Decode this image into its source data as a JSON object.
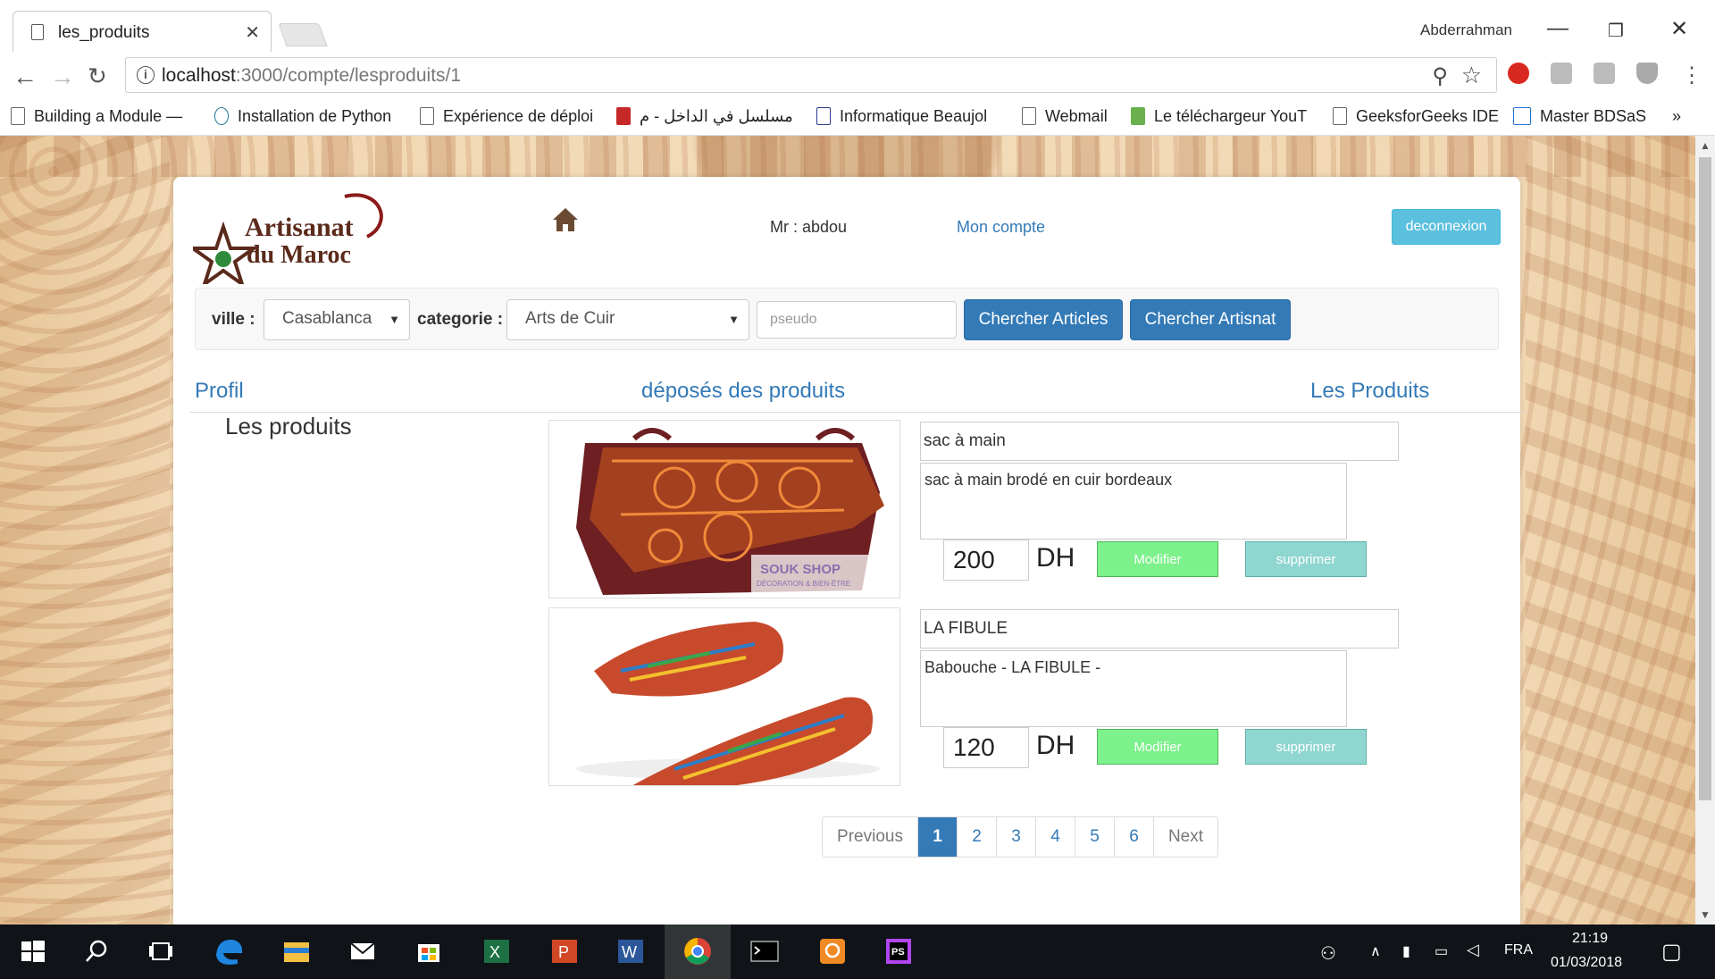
{
  "browser": {
    "tab_title": "les_produits",
    "user": "Abderrahman",
    "url_host": "localhost",
    "url_rest": ":3000/compte/lesproduits/1",
    "bookmarks": [
      "Building a Module —",
      "Installation de Python",
      "Expérience de déploi",
      "مسلسل في الداخل - م",
      "Informatique Beaujol",
      "Webmail",
      "Le téléchargeur YouT",
      "GeeksforGeeks IDE",
      "Master BDSaS"
    ],
    "more": "»"
  },
  "header": {
    "logo_line1": "Artisanat",
    "logo_line2": "du Maroc",
    "greeting": "Mr : abdou",
    "account_link": "Mon compte",
    "logout": "deconnexion"
  },
  "search": {
    "ville_label": "ville :",
    "ville_value": "Casablanca",
    "categorie_label": "categorie :",
    "categorie_value": "Arts de Cuir",
    "pseudo_placeholder": "pseudo",
    "btn_articles": "Chercher Articles",
    "btn_artisanat": "Chercher Artisnat"
  },
  "nav": {
    "profil": "Profil",
    "deposes": "déposés des produits",
    "produits": "Les Produits"
  },
  "sidebar_title": "Les produits",
  "products": [
    {
      "name": "sac à main",
      "description": "sac à main brodé en cuir bordeaux",
      "price": "200",
      "currency": "DH",
      "watermark": "SOUK SHOP",
      "watermark_sub": "DÉCORATION & BIEN-ÊTRE",
      "modify": "Modifier",
      "delete": "supprimer"
    },
    {
      "name": "LA FIBULE",
      "description": "Babouche - LA FIBULE -",
      "price": "120",
      "currency": "DH",
      "modify": "Modifier",
      "delete": "supprimer"
    }
  ],
  "pagination": {
    "prev": "Previous",
    "pages": [
      "1",
      "2",
      "3",
      "4",
      "5",
      "6"
    ],
    "active": "1",
    "next": "Next"
  },
  "taskbar": {
    "lang": "FRA",
    "time": "21:19",
    "date": "01/03/2018"
  }
}
